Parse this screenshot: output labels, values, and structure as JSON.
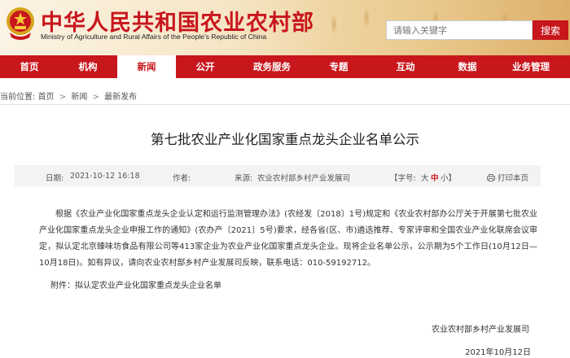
{
  "header": {
    "site_title": "中华人民共和国农业农村部",
    "site_subtitle": "Ministry of Agriculture and Rural Affairs of the People's Republic of China",
    "emblem_icon": "national-emblem-icon",
    "search_placeholder": "请输入关键字",
    "search_button": "搜索",
    "brand_color": "#c8161d"
  },
  "nav": {
    "items": [
      {
        "label": "首页"
      },
      {
        "label": "机构"
      },
      {
        "label": "新闻"
      },
      {
        "label": "公开"
      },
      {
        "label": "政务服务"
      },
      {
        "label": "专题"
      },
      {
        "label": "互动"
      },
      {
        "label": "数据"
      },
      {
        "label": "业务管理"
      }
    ],
    "active": "新闻"
  },
  "breadcrumb": {
    "prefix": "当前位置:",
    "items": [
      "首页",
      "新闻",
      "最新发布"
    ],
    "separator": ">"
  },
  "article": {
    "title": "第七批农业产业化国家重点龙头企业名单公示",
    "meta": {
      "date_label": "日期:",
      "date": "2021-10-12 16:18",
      "author_label": "作者:",
      "source_label": "来源:",
      "source": "农业农村部乡村产业发展司",
      "font_size_label": "【字号:",
      "size_large": "大",
      "size_medium": "中",
      "size_small": "小】",
      "print_label": "打印本页",
      "print_icon": "printer-icon"
    },
    "body": "根据《农业产业化国家重点龙头企业认定和运行监测管理办法》(农经发〔2018〕1号)规定和《农业农村部办公厅关于开展第七批农业产业化国家重点龙头企业申报工作的通知》(农办产〔2021〕5号)要求，经各省(区、市)遴选推荐、专家评审和全国农业产业化联席会议审定，拟认定北京臻味坊食品有限公司等413家企业为农业产业化国家重点龙头企业。现将企业名单公示，公示期为5个工作日(10月12日—10月18日)。如有异议，请向农业农村部乡村产业发展司反映，联系电话：010-59192712。",
    "attachment_label": "附件：",
    "attachment_link": "拟认定农业产业化国家重点龙头企业名单",
    "signature_org": "农业农村部乡村产业发展司",
    "signature_date": "2021年10月12日"
  }
}
